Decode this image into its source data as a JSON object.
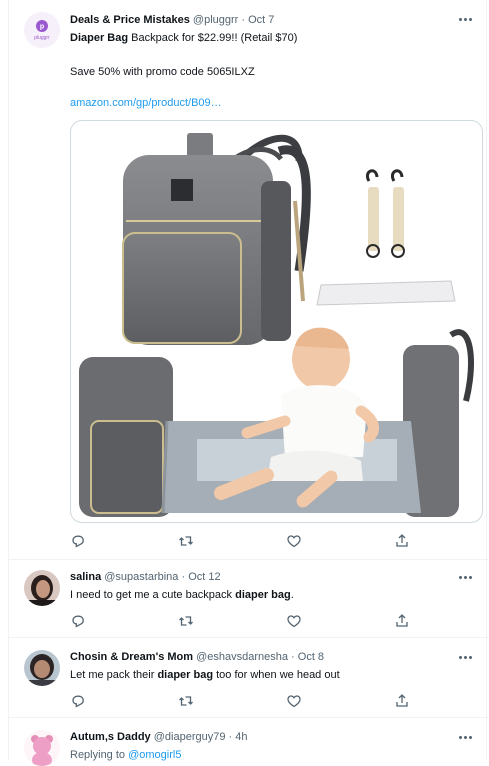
{
  "main_tweet": {
    "avatar_text": "pluggrr",
    "name": "Deals & Price Mistakes",
    "handle": "@pluggrr",
    "date": "Oct 7",
    "line1_bold": "Diaper Bag",
    "line1_rest": " Backpack for $22.99!! (Retail $70)",
    "line2": "Save 50% with promo code 5065ILXZ",
    "link": "amazon.com/gp/product/B09…",
    "image_icon": "diaper-bag-product-photo"
  },
  "replies": [
    {
      "name": "salina",
      "handle": "@supastarbina",
      "date": "Oct 12",
      "text_before": "I need to get me a cute backpack ",
      "text_bold": "diaper bag",
      "text_after": "."
    },
    {
      "name": "Chosin & Dream's Mom",
      "handle": "@eshavsdarnesha",
      "date": "Oct 8",
      "text_before": "Let me pack their ",
      "text_bold": "diaper bag",
      "text_after": " too for when we head out"
    },
    {
      "name": "Autum,s Daddy",
      "handle": "@diaperguy79",
      "date": "4h",
      "replying_label": "Replying to ",
      "replying_handle": "@omogirl5"
    }
  ],
  "separator": " · ",
  "icons": {
    "reply": "reply-icon",
    "retweet": "retweet-icon",
    "like": "heart-icon",
    "share": "share-icon",
    "more": "more-icon"
  },
  "colors": {
    "accent": "#1d9bf0",
    "secondary_text": "#536471",
    "border": "#eff3f4",
    "avatar_purple": "#9b59d0"
  }
}
